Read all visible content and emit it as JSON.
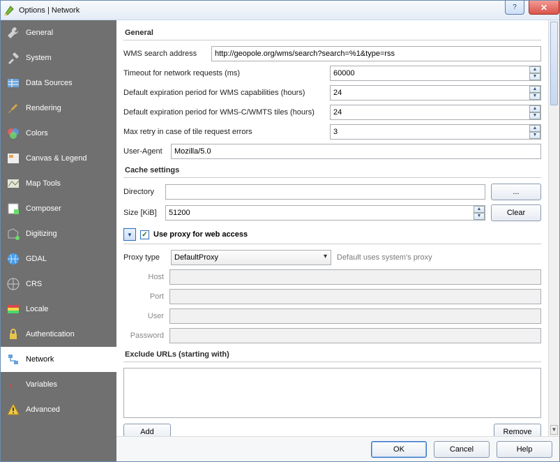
{
  "window": {
    "title": "Options | Network"
  },
  "sidebar": {
    "items": [
      {
        "label": "General"
      },
      {
        "label": "System"
      },
      {
        "label": "Data Sources"
      },
      {
        "label": "Rendering"
      },
      {
        "label": "Colors"
      },
      {
        "label": "Canvas & Legend"
      },
      {
        "label": "Map Tools"
      },
      {
        "label": "Composer"
      },
      {
        "label": "Digitizing"
      },
      {
        "label": "GDAL"
      },
      {
        "label": "CRS"
      },
      {
        "label": "Locale"
      },
      {
        "label": "Authentication"
      },
      {
        "label": "Network",
        "active": true
      },
      {
        "label": "Variables"
      },
      {
        "label": "Advanced"
      }
    ]
  },
  "general": {
    "header": "General",
    "wms_label": "WMS search address",
    "wms_value": "http://geopole.org/wms/search?search=%1&type=rss",
    "timeout_label": "Timeout for network requests (ms)",
    "timeout_value": "60000",
    "wms_cap_label": "Default expiration period for WMS capabilities (hours)",
    "wms_cap_value": "24",
    "wmsc_label": "Default expiration period for WMS-C/WMTS tiles (hours)",
    "wmsc_value": "24",
    "retry_label": "Max retry in case of tile request errors",
    "retry_value": "3",
    "ua_label": "User-Agent",
    "ua_value": "Mozilla/5.0"
  },
  "cache": {
    "header": "Cache settings",
    "dir_label": "Directory",
    "dir_value": "",
    "browse": "...",
    "size_label": "Size [KiB]",
    "size_value": "51200",
    "clear": "Clear"
  },
  "proxy": {
    "header": "Use proxy for web access",
    "type_label": "Proxy type",
    "type_value": "DefaultProxy",
    "type_hint": "Default uses system's proxy",
    "host_label": "Host",
    "port_label": "Port",
    "user_label": "User",
    "pass_label": "Password",
    "exclude_header": "Exclude URLs (starting with)",
    "add": "Add",
    "remove": "Remove"
  },
  "footer": {
    "ok": "OK",
    "cancel": "Cancel",
    "help": "Help"
  }
}
